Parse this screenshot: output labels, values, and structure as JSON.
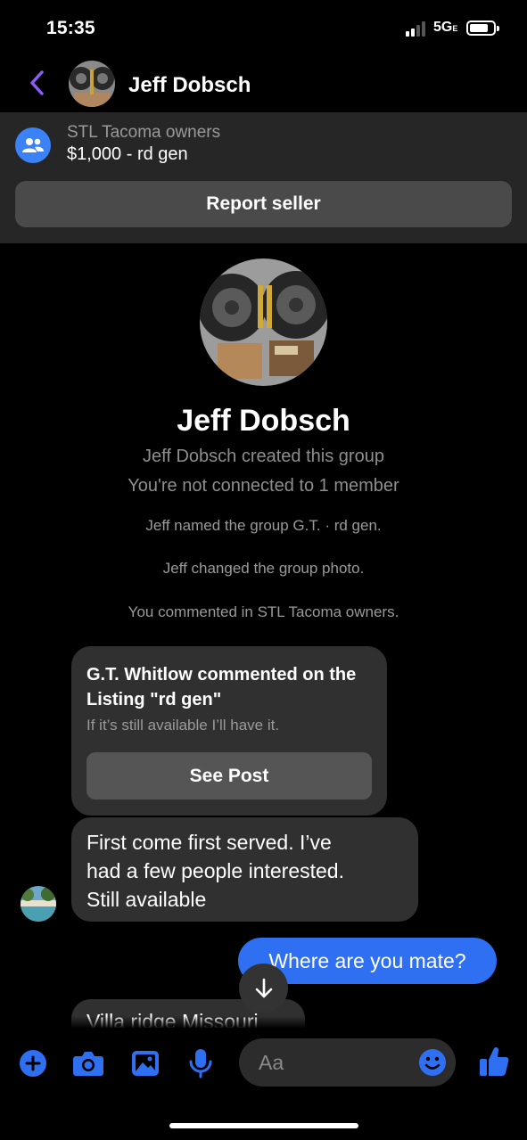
{
  "status_bar": {
    "time": "15:35",
    "network": "5G",
    "network_suffix": "E"
  },
  "header": {
    "contact_name": "Jeff Dobsch"
  },
  "listing": {
    "group_name": "STL Tacoma owners",
    "title": "$1,000 - rd gen",
    "report_label": "Report seller"
  },
  "profile": {
    "name": "Jeff Dobsch",
    "created_text": "Jeff Dobsch created this group",
    "connection_text": "You're not connected to 1 member"
  },
  "events": [
    "Jeff named the group G.T. · rd gen.",
    "Jeff changed the group photo.",
    "You commented in STL Tacoma owners."
  ],
  "comment_card": {
    "title": "G.T. Whitlow commented on the Listing \"rd gen\"",
    "text": "If it’s still available I’ll have it.",
    "button_label": "See Post"
  },
  "messages": {
    "incoming_1": [
      "First come first served.  I’ve",
      "had a few people interested.",
      "Still available"
    ],
    "outgoing_1": "Where are you mate?",
    "incoming_2": "Villa ridge Missouri"
  },
  "composer": {
    "placeholder": "Aa"
  },
  "colors": {
    "accent": "#2f6ff2",
    "back": "#8b5cf6",
    "icon_blue": "#3b82f6"
  }
}
